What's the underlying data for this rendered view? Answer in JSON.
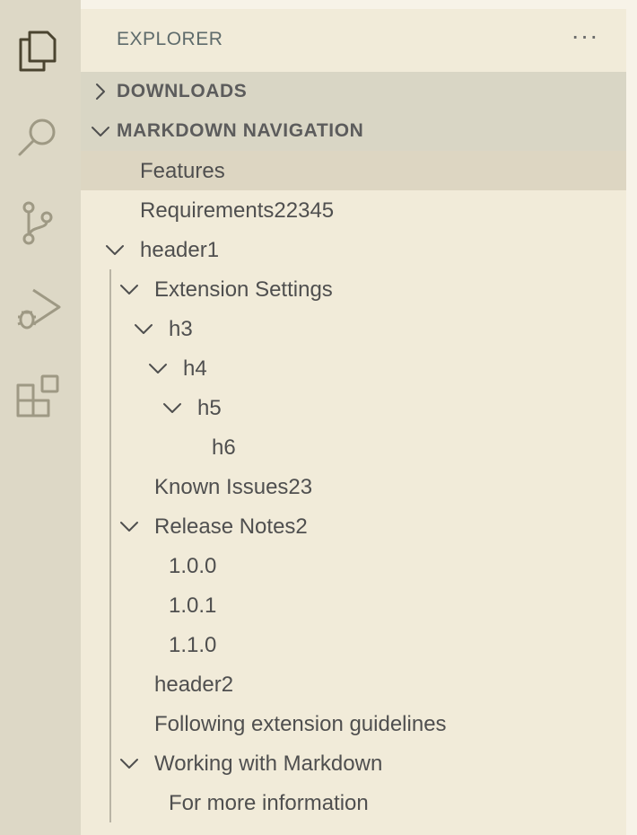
{
  "activity_bar": {
    "items": [
      {
        "name": "explorer",
        "icon": "files-icon"
      },
      {
        "name": "search",
        "icon": "search-icon"
      },
      {
        "name": "source-control",
        "icon": "source-control-icon"
      },
      {
        "name": "run-debug",
        "icon": "run-debug-icon"
      },
      {
        "name": "extensions",
        "icon": "extensions-icon"
      }
    ]
  },
  "sidebar": {
    "title": "EXPLORER",
    "more_actions": "···",
    "sections": [
      {
        "label": "DOWNLOADS",
        "expanded": false
      },
      {
        "label": "MARKDOWN NAVIGATION",
        "expanded": true
      }
    ],
    "tree": [
      {
        "label": "Features",
        "depth": 0,
        "twisty": "none",
        "selected": true
      },
      {
        "label": "Requirements22345",
        "depth": 0,
        "twisty": "none"
      },
      {
        "label": "header1",
        "depth": 0,
        "twisty": "expanded"
      },
      {
        "label": "Extension Settings",
        "depth": 1,
        "twisty": "expanded"
      },
      {
        "label": "h3",
        "depth": 2,
        "twisty": "expanded"
      },
      {
        "label": "h4",
        "depth": 3,
        "twisty": "expanded"
      },
      {
        "label": "h5",
        "depth": 4,
        "twisty": "expanded"
      },
      {
        "label": "h6",
        "depth": 5,
        "twisty": "none"
      },
      {
        "label": "Known Issues23",
        "depth": 1,
        "twisty": "none"
      },
      {
        "label": "Release Notes2",
        "depth": 1,
        "twisty": "expanded"
      },
      {
        "label": "1.0.0",
        "depth": 2,
        "twisty": "none"
      },
      {
        "label": "1.0.1",
        "depth": 2,
        "twisty": "none"
      },
      {
        "label": "1.1.0",
        "depth": 2,
        "twisty": "none"
      },
      {
        "label": "header2",
        "depth": 1,
        "twisty": "none"
      },
      {
        "label": "Following extension guidelines",
        "depth": 1,
        "twisty": "none"
      },
      {
        "label": "Working with Markdown",
        "depth": 1,
        "twisty": "expanded"
      },
      {
        "label": "For more information",
        "depth": 2,
        "twisty": "none"
      }
    ]
  },
  "colors": {
    "activity_bar_bg": "#ddd8c6",
    "sidebar_bg": "#f1ebd9",
    "section_header_bg": "#d9d6c5",
    "selected_row_bg": "#ddd6c2",
    "text": "#4f4f4f",
    "icon_active": "#4a4430",
    "icon_inactive": "#9e9984"
  }
}
